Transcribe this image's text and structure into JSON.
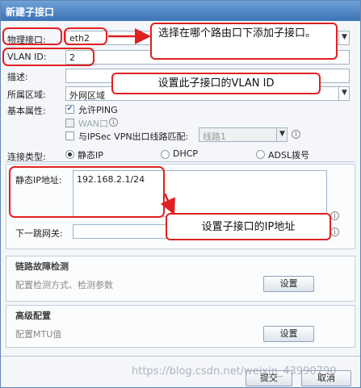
{
  "dialog": {
    "title": "新建子接口"
  },
  "form": {
    "physical_interface": {
      "label": "物理接口:",
      "value": "eth2"
    },
    "vlan_id": {
      "label": "VLAN ID:",
      "value": "2"
    },
    "description": {
      "label": "描述:",
      "value": ""
    },
    "zone": {
      "label": "所属区域:",
      "value": "外网区域"
    },
    "basic_attr": {
      "label": "基本属性:",
      "allow_ping": {
        "label": "允许PING",
        "checked": true
      },
      "wan_port": {
        "label": "WAN口",
        "checked": false
      },
      "ipsec_match": {
        "label": "与IPSec VPN出口线路匹配:",
        "checked": false,
        "line_value": "线路1"
      }
    },
    "connection_type": {
      "label": "连接类型:",
      "options": [
        "静态IP",
        "DHCP",
        "ADSL拨号"
      ],
      "selected": "静态IP"
    },
    "static_ip": {
      "label": "静态IP地址:",
      "value": "192.168.2.1/24"
    },
    "gateway": {
      "label": "下一跳网关:",
      "value": ""
    }
  },
  "sections": {
    "link_detect": {
      "title": "链路故障检测",
      "desc": "配置检测方式、检测参数",
      "button": "设置"
    },
    "advanced": {
      "title": "高级配置",
      "desc": "配置MTU值",
      "button": "设置"
    }
  },
  "footer": {
    "ok": "提交",
    "cancel": "取消"
  },
  "annotations": {
    "a1": "选择在哪个路由口下添加子接口。",
    "a2": "设置此子接口的VLAN ID",
    "a3": "设置子接口的IP地址"
  },
  "watermark": "https://blog.csdn.net/weixin_43990790",
  "colors": {
    "title_bar": "#3c73b6",
    "annotation": "#e02020"
  }
}
